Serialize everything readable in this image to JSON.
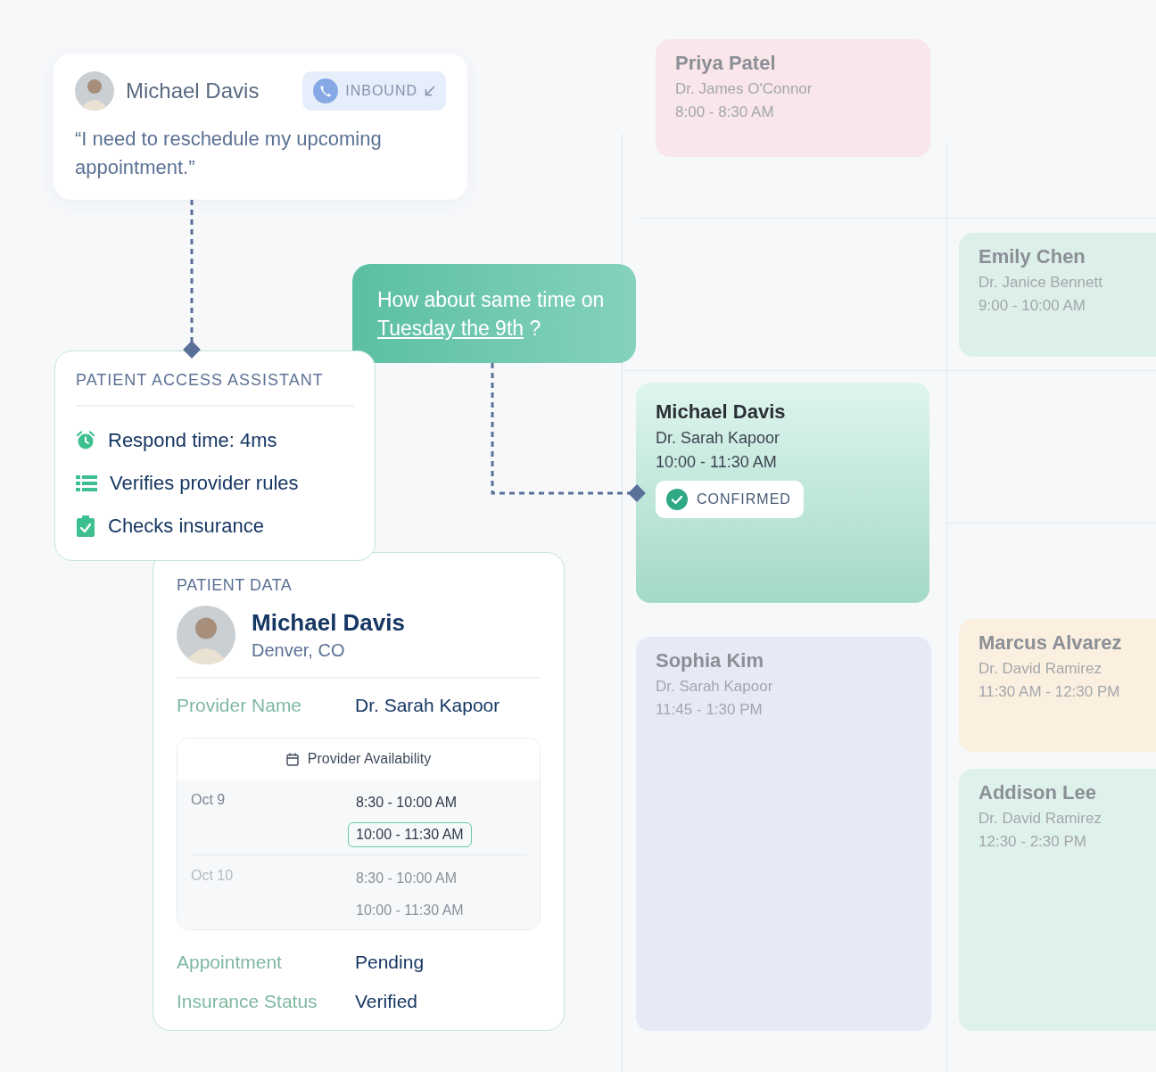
{
  "call_card": {
    "caller": "Michael Davis",
    "direction": "INBOUND",
    "quote": "“I need to reschedule my upcoming appointment.”"
  },
  "assistant": {
    "title": "PATIENT ACCESS ASSISTANT",
    "features": [
      {
        "kind": "clock",
        "text": "Respond time: 4ms"
      },
      {
        "kind": "list",
        "text": "Verifies provider rules"
      },
      {
        "kind": "clipboard",
        "text": "Checks insurance"
      }
    ]
  },
  "reply_bubble": {
    "text_before": "How about same time on",
    "link": "Tuesday the 9th",
    "text_after": "?"
  },
  "patient_data": {
    "title": "PATIENT DATA",
    "name": "Michael Davis",
    "location": "Denver, CO",
    "provider": {
      "label": "Provider Name",
      "value": "Dr. Sarah Kapoor"
    },
    "availability": {
      "title": "Provider Availability",
      "days": [
        {
          "date": "Oct 9",
          "faded": false,
          "slots": [
            {
              "time": "8:30 - 10:00 AM",
              "selected": false
            },
            {
              "time": "10:00 - 11:30 AM",
              "selected": true
            }
          ]
        },
        {
          "date": "Oct 10",
          "faded": true,
          "slots": [
            {
              "time": "8:30 - 10:00 AM",
              "selected": false
            },
            {
              "time": "10:00 - 11:30 AM",
              "selected": false
            }
          ]
        }
      ]
    },
    "fields": [
      {
        "label": "Appointment",
        "value": "Pending"
      },
      {
        "label": "Insurance Status",
        "value": "Verified"
      }
    ]
  },
  "calendar": {
    "events": [
      {
        "name": "Priya Patel",
        "provider": "Dr. James O'Connor",
        "time": "8:00 - 8:30 AM",
        "color": "#f9e6ea",
        "focused": false
      },
      {
        "name": "Emily Chen",
        "provider": "Dr. Janice Bennett",
        "time": "9:00 - 10:00 AM",
        "color": "#dcefe8",
        "focused": false
      },
      {
        "name": "Michael Davis",
        "provider": "Dr. Sarah Kapoor",
        "time": "10:00 - 11:30 AM",
        "color": "#a3d9c8",
        "focused": true,
        "status": "CONFIRMED"
      },
      {
        "name": "Sophia Kim",
        "provider": "Dr. Sarah Kapoor",
        "time": "11:45 - 1:30 PM",
        "color": "#e7eaf6",
        "focused": false
      },
      {
        "name": "Marcus Alvarez",
        "provider": "Dr. David Ramirez",
        "time": "11:30 AM - 12:30 PM",
        "color": "#fbf0df",
        "focused": false
      },
      {
        "name": "Addison Lee",
        "provider": "Dr. David Ramirez",
        "time": "12:30 - 2:30 PM",
        "color": "#dff1eb",
        "focused": false
      }
    ]
  }
}
